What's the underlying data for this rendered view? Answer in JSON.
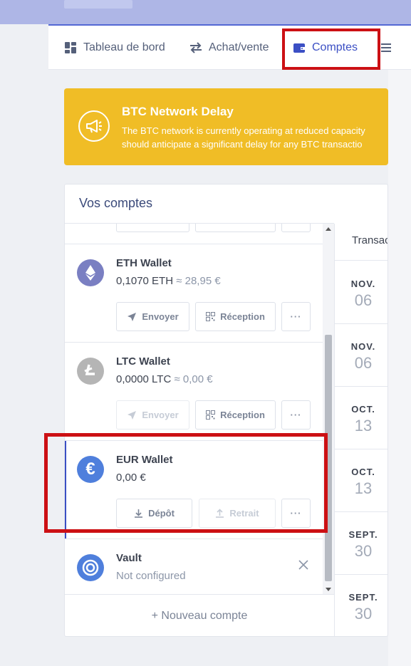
{
  "nav": {
    "items": [
      {
        "label": "Tableau de bord",
        "icon": "dashboard-icon",
        "active": false
      },
      {
        "label": "Achat/vente",
        "icon": "swap-icon",
        "active": false
      },
      {
        "label": "Comptes",
        "icon": "wallet-icon",
        "active": true
      }
    ]
  },
  "banner": {
    "title": "BTC Network Delay",
    "text": "The BTC network is currently operating at reduced capacity\nshould anticipate a significant delay for any BTC transactio",
    "icon": "megaphone-icon",
    "color": "#f0bd26"
  },
  "accounts": {
    "title": "Vos comptes",
    "wallets": [
      {
        "name": "ETH Wallet",
        "amount": "0,1070 ETH",
        "approx": "≈ 28,95 €",
        "icon": "ethereum-icon",
        "color": "#7a7fc2",
        "buttons": {
          "send": "Envoyer",
          "receive": "Réception",
          "more": "···"
        }
      },
      {
        "name": "LTC Wallet",
        "amount": "0,0000 LTC",
        "approx": "≈ 0,00 €",
        "icon": "litecoin-icon",
        "color": "#b5b5b5",
        "buttons": {
          "send": "Envoyer",
          "receive": "Réception",
          "more": "···"
        }
      },
      {
        "name": "EUR Wallet",
        "amount": "0,00 €",
        "approx": "",
        "icon": "euro-icon",
        "color": "#4f7fdc",
        "buttons": {
          "deposit": "Dépôt",
          "withdraw": "Retrait",
          "more": "···"
        }
      },
      {
        "name": "Vault",
        "amount": "Not configured",
        "icon": "vault-icon",
        "color": "#4f7fdc"
      }
    ],
    "new_account": "+ Nouveau compte"
  },
  "transactions": {
    "header": "Transactions",
    "dates": [
      {
        "month": "NOV.",
        "day": "06"
      },
      {
        "month": "NOV.",
        "day": "06"
      },
      {
        "month": "OCT.",
        "day": "13"
      },
      {
        "month": "OCT.",
        "day": "13"
      },
      {
        "month": "SEPT.",
        "day": "30"
      },
      {
        "month": "SEPT.",
        "day": "30"
      }
    ]
  },
  "colors": {
    "accent": "#3b4fc4",
    "highlight": "#cc1014",
    "banner": "#f0bd26"
  }
}
